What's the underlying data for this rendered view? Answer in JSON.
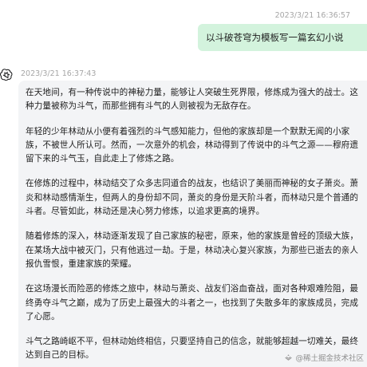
{
  "user_message": {
    "timestamp": "2023/3/21 16:36:57",
    "text": "以斗破苍穹为模板写一篇玄幻小说"
  },
  "bot_message": {
    "avatar_icon": "openai-logo-icon",
    "timestamp": "2023/3/21 16:37:43",
    "paragraphs": [
      "在天地间，有一种传说中的神秘力量，能够让人突破生死界限，修炼成为强大的战士。这种力量被称为斗气，而那些拥有斗气的人则被视为无敌存在。",
      "年轻的少年林动从小便有着强烈的斗气感知能力，但他的家族却是一个默默无闻的小家族，不被世人所认可。然而，一次意外的机会，林动得到了传说中的斗气之源——穆府遗留下来的斗气玉，自此走上了修炼之路。",
      "在修炼的过程中，林动结交了众多志同道合的战友，也结识了美丽而神秘的女子萧炎。萧炎和林动感情渐生，但两人的身份却不同，萧炎的身份是天阶斗者，而林动只是个普通的斗者。尽管如此，林动还是决心努力修炼，以追求更高的境界。",
      "随着修炼的深入，林动逐渐发现了自己家族的秘密，原来，他的家族是曾经的顶级大族，在某场大战中被灭门，只有他逃过一劫。于是，林动决心复兴家族，为那些已逝去的亲人报仇雪恨，重建家族的荣耀。",
      "在这场漫长而险恶的修炼之旅中，林动与萧炎、战友们浴血奋战，面对各种艰难险阻，最终勇夺斗气之巅，成为了历史上最强大的斗者之一，也找到了失散多年的家族成员，完成了心愿。",
      "斗气之路崎岖不平，但林动始终相信，只要坚持自己的信念，就能够超越一切难关，最终达到自己的目标。"
    ]
  },
  "watermark": {
    "icon": "juejin-logo-icon",
    "text": "@稀土掘金技术社区"
  },
  "colors": {
    "user_bubble": "#d3f3dd",
    "bot_bubble": "#f3f4f6",
    "timestamp": "#a6a6a6"
  }
}
